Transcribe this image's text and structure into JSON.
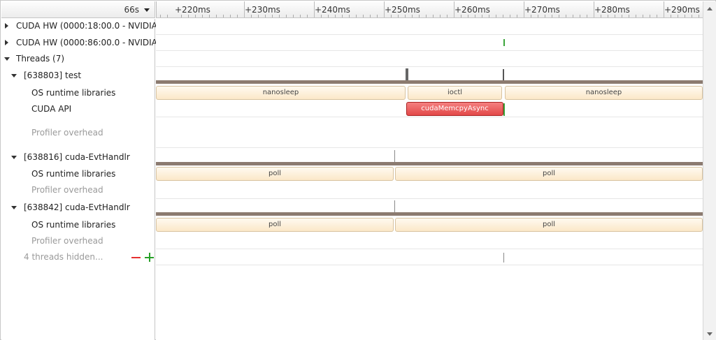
{
  "header": {
    "zoom_label": "66s"
  },
  "ruler": {
    "ticks": [
      "+220ms",
      "+230ms",
      "+240ms",
      "+250ms",
      "+260ms",
      "+270ms",
      "+280ms",
      "+290ms"
    ]
  },
  "tree": {
    "gpu1": "CUDA HW (0000:18:00.0 - NVIDIA",
    "gpu2": "CUDA HW (0000:86:00.0 - NVIDIA",
    "threads": "Threads (7)",
    "thread1": {
      "label": "[638803] test",
      "os_runtime": "OS runtime libraries",
      "cuda_api": "CUDA API",
      "profiler": "Profiler overhead"
    },
    "thread2": {
      "label": "[638816] cuda-EvtHandlr",
      "os_runtime": "OS runtime libraries",
      "profiler": "Profiler overhead"
    },
    "thread3": {
      "label": "[638842] cuda-EvtHandlr",
      "os_runtime": "OS runtime libraries",
      "profiler": "Profiler overhead"
    },
    "hidden": "4 threads hidden..."
  },
  "timeline": {
    "thread1_os": [
      "nanosleep",
      "ioctl",
      "nanosleep"
    ],
    "thread1_cuda": "cudaMemcpyAsync",
    "thread2_os": [
      "poll",
      "poll"
    ],
    "thread3_os": [
      "poll",
      "poll"
    ]
  },
  "colors": {
    "os_runtime_fill": "#fbe8c8",
    "cuda_api_fill": "#e34848",
    "thread_bar": "#8c7b70",
    "marker_green": "#3aa53a"
  }
}
